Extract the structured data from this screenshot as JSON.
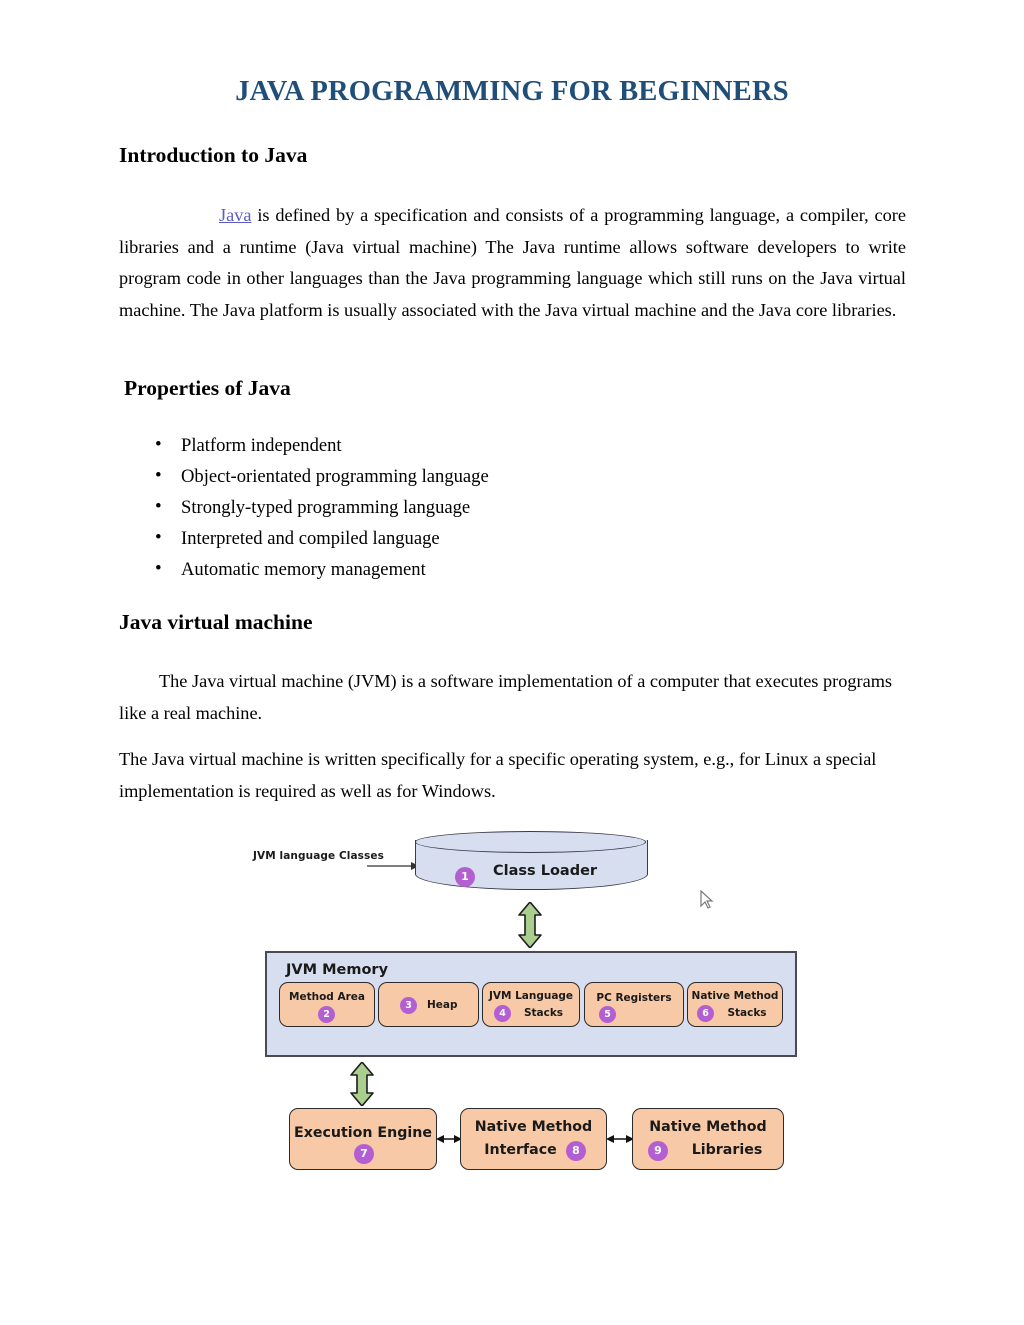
{
  "document": {
    "title": "JAVA PROGRAMMING FOR BEGINNERS",
    "title_color": "#1F4E79",
    "link_color": "#5D5DC8"
  },
  "sections": {
    "intro": {
      "heading": "Introduction to Java",
      "link_text": "Java",
      "paragraph_rest": " is defined by a specification and consists of a programming language, a compiler, core libraries and a runtime (Java virtual machine) The Java runtime allows software developers to write program code in other languages than the Java programming language which still runs on the Java virtual machine. The Java platform is usually associated with the Java virtual machine and the Java core libraries."
    },
    "properties": {
      "heading": "Properties of Java",
      "items": [
        "Platform independent",
        "Object-orientated programming language",
        "Strongly-typed programming language",
        "Interpreted and compiled language",
        "Automatic memory management"
      ]
    },
    "jvm": {
      "heading": "Java virtual machine",
      "paragraph_1": "The Java virtual machine (JVM) is a software implementation of a computer that executes programs like a real machine.",
      "paragraph_2": "The Java virtual machine is written specifically for a specific operating system, e.g., for Linux a special implementation is required as well as for Windows."
    }
  },
  "diagram": {
    "source_label": "JVM language Classes",
    "class_loader": {
      "label": "Class Loader",
      "number": "1"
    },
    "jvm_memory": {
      "title": "JVM Memory",
      "boxes": [
        {
          "label": "Method Area",
          "number": "2"
        },
        {
          "label": "Heap",
          "number": "3"
        },
        {
          "label_line1": "JVM Language",
          "label_line2": "Stacks",
          "number": "4"
        },
        {
          "label": "PC Registers",
          "number": "5"
        },
        {
          "label_line1": "Native Method",
          "label_line2": "Stacks",
          "number": "6"
        }
      ]
    },
    "bottom_row": [
      {
        "label_line1": "Execution Engine",
        "label_line2": "",
        "number": "7"
      },
      {
        "label_line1": "Native Method",
        "label_line2": "Interface",
        "number": "8"
      },
      {
        "label_line1": "Native Method",
        "label_line2": "Libraries",
        "number": "9"
      }
    ],
    "colors": {
      "cylinder_fill": "#D6DEF0",
      "memory_fill": "#D6DEF0",
      "box_fill": "#F7C9A6",
      "badge_fill": "#B35FD2",
      "arrow_fill": "#A9CE8E"
    }
  }
}
